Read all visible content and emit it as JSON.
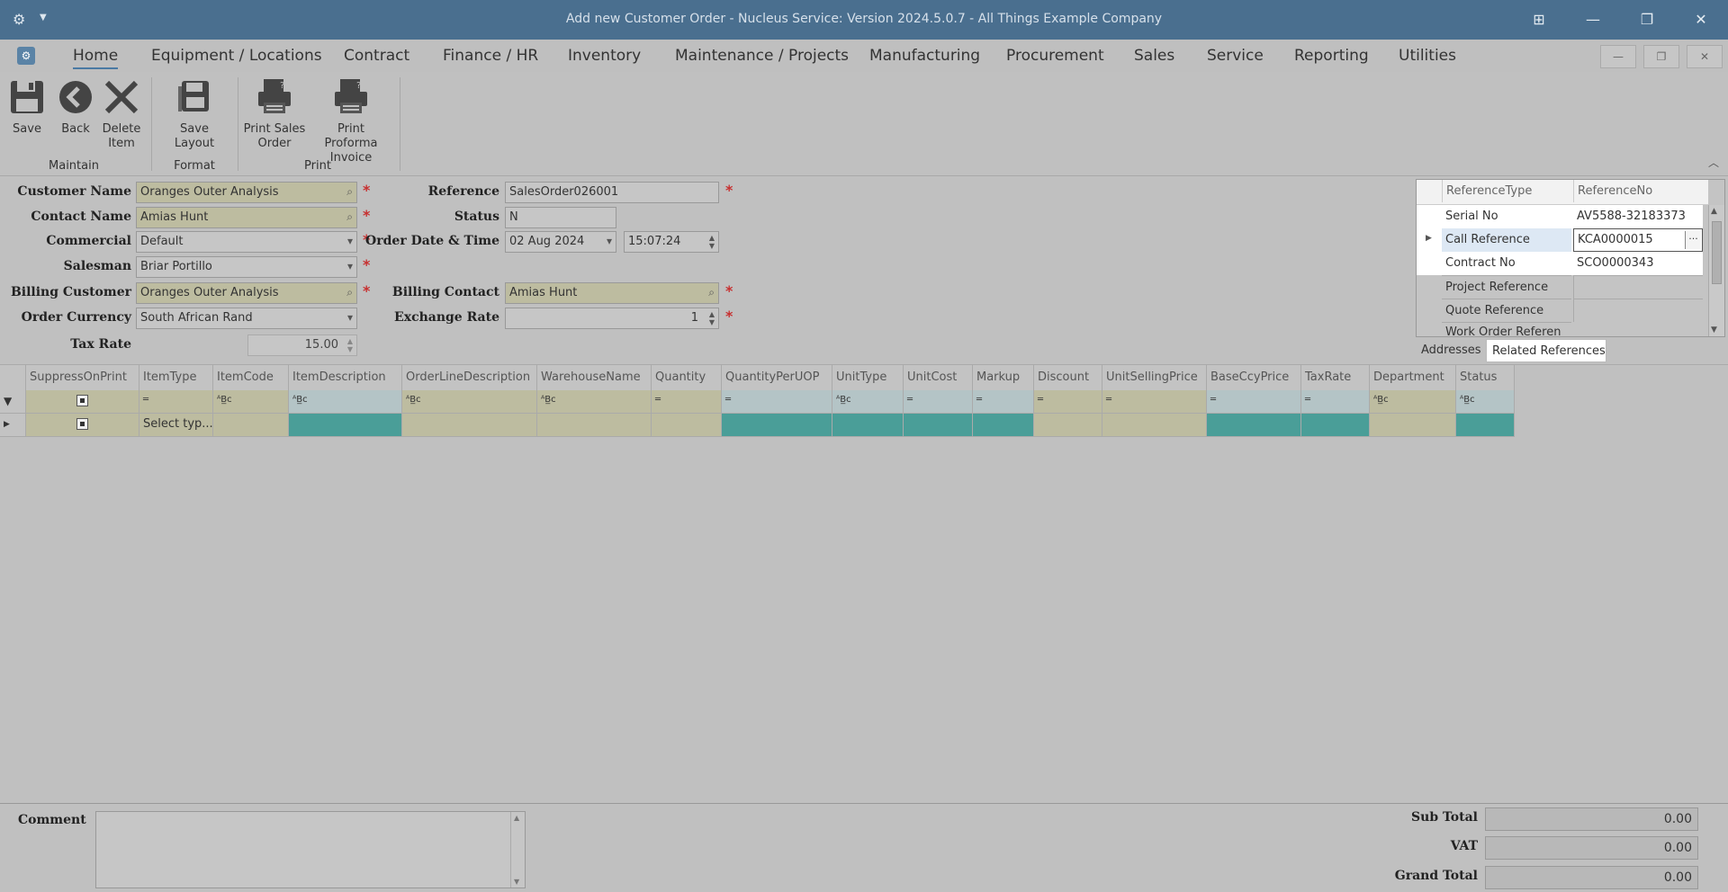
{
  "window": {
    "title": "Add new Customer Order - Nucleus Service: Version 2024.5.0.7 - All Things Example Company"
  },
  "menu": {
    "tabs": [
      "Home",
      "Equipment / Locations",
      "Contract",
      "Finance / HR",
      "Inventory",
      "Maintenance / Projects",
      "Manufacturing",
      "Procurement",
      "Sales",
      "Service",
      "Reporting",
      "Utilities"
    ],
    "active": "Home"
  },
  "ribbon": {
    "save": "Save",
    "back": "Back",
    "delete_line1": "Delete",
    "delete_line2": "Item",
    "save_layout": "Save Layout",
    "print_sales_line1": "Print Sales",
    "print_sales_line2": "Order",
    "print_proforma_line1": "Print Proforma",
    "print_proforma_line2": "Invoice",
    "groups": {
      "maintain": "Maintain",
      "format": "Format",
      "print": "Print"
    }
  },
  "form": {
    "customer_name": {
      "label": "Customer Name",
      "value": "Oranges Outer Analysis"
    },
    "contact_name": {
      "label": "Contact Name",
      "value": "Amias Hunt"
    },
    "commercial": {
      "label": "Commercial",
      "value": "Default"
    },
    "salesman": {
      "label": "Salesman",
      "value": "Briar Portillo"
    },
    "billing_customer": {
      "label": "Billing Customer",
      "value": "Oranges Outer Analysis"
    },
    "order_currency": {
      "label": "Order Currency",
      "value": "South African Rand"
    },
    "tax_rate": {
      "label": "Tax Rate",
      "value": "15.00"
    },
    "reference": {
      "label": "Reference",
      "value": "SalesOrder026001"
    },
    "status": {
      "label": "Status",
      "value": "N"
    },
    "order_date": {
      "label": "Order Date & Time",
      "date": "02 Aug 2024",
      "time": "15:07:24"
    },
    "billing_contact": {
      "label": "Billing Contact",
      "value": "Amias Hunt"
    },
    "exchange_rate": {
      "label": "Exchange Rate",
      "value": "1"
    }
  },
  "references": {
    "headers": [
      "ReferenceType",
      "ReferenceNo"
    ],
    "rows": [
      {
        "type": "Serial No",
        "no": "AV5588-32183373"
      },
      {
        "type": "Call Reference",
        "no": "KCA0000015"
      },
      {
        "type": "Contract No",
        "no": "SCO0000343"
      },
      {
        "type": "Project Reference",
        "no": ""
      },
      {
        "type": "Quote Reference",
        "no": ""
      },
      {
        "type": "Work Order Referen",
        "no": ""
      }
    ],
    "tabs": [
      "Addresses",
      "Related References"
    ],
    "active_tab": "Related References"
  },
  "lines": {
    "columns": [
      "SuppressOnPrint",
      "ItemType",
      "ItemCode",
      "ItemDescription",
      "OrderLineDescription",
      "WarehouseName",
      "Quantity",
      "QuantityPerUOP",
      "UnitType",
      "UnitCost",
      "Markup",
      "Discount",
      "UnitSellingPrice",
      "BaseCcyPrice",
      "TaxRate",
      "Department",
      "Status"
    ],
    "new_row_itemtype": "Select typ..."
  },
  "footer": {
    "comment_label": "Comment",
    "sub_total": {
      "label": "Sub Total",
      "value": "0.00"
    },
    "vat": {
      "label": "VAT",
      "value": "0.00"
    },
    "grand_total": {
      "label": "Grand Total",
      "value": "0.00"
    }
  },
  "colors": {
    "titlebar": "#4a6f8f",
    "required_field": "#bdbca0",
    "teal_cell": "#4a9e98",
    "required_star": "#c73030"
  }
}
